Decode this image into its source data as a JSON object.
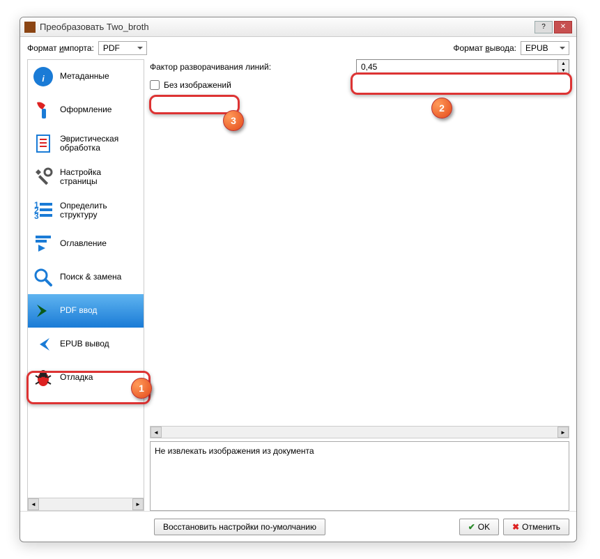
{
  "window": {
    "title": "Преобразовать Two_broth"
  },
  "toprow": {
    "import_label_pre": "Формат ",
    "import_label_u": "и",
    "import_label_post": "мпорта:",
    "import_value": "PDF",
    "output_label_pre": "Формат ",
    "output_label_u": "в",
    "output_label_post": "ывода:",
    "output_value": "EPUB"
  },
  "sidebar": {
    "items": [
      {
        "label": "Метаданные"
      },
      {
        "label": "Оформление"
      },
      {
        "label": "Эвристическая обработка"
      },
      {
        "label": "Настройка страницы"
      },
      {
        "label": "Определить структуру"
      },
      {
        "label": "Оглавление"
      },
      {
        "label": "Поиск & замена"
      },
      {
        "label": "PDF ввод"
      },
      {
        "label": "EPUB вывод"
      },
      {
        "label": "Отладка"
      }
    ]
  },
  "main": {
    "unwrap_label": "Фактор разворачивания линий:",
    "unwrap_value": "0,45",
    "noimg_label_pre": "Без и",
    "noimg_label_u": "з",
    "noimg_label_post": "ображений",
    "desc": "Не извлекать изображения из документа"
  },
  "footer": {
    "restore": "Восстановить настройки по-умолчанию",
    "ok": "OK",
    "cancel": "Отменить"
  },
  "annotations": {
    "b1": "1",
    "b2": "2",
    "b3": "3"
  }
}
